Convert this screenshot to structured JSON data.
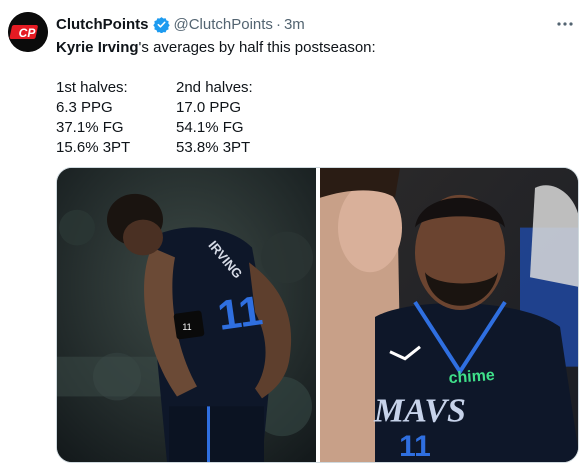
{
  "author": {
    "name": "ClutchPoints",
    "handle": "@ClutchPoints",
    "separator": "·",
    "time": "3m",
    "avatar_text": "CP",
    "verified_icon": "verified-badge-icon"
  },
  "tweet": {
    "mention": "Kyrie Irving",
    "rest": "'s averages by half this postseason:"
  },
  "stats": {
    "first": {
      "heading": "1st halves:",
      "ppg": "6.3 PPG",
      "fg": "37.1% FG",
      "three": "15.6% 3PT"
    },
    "second": {
      "heading": "2nd halves:",
      "ppg": "17.0 PPG",
      "fg": "54.1% FG",
      "three": "53.8% 3PT"
    }
  },
  "media": {
    "left_jersey_name": "IRVING",
    "left_jersey_number": "11",
    "right_sponsor": "chime",
    "right_team": "MAVS",
    "right_number": "11",
    "wristband": "11"
  },
  "colors": {
    "brand_red": "#e51b23",
    "verified_blue": "#1d9bf0",
    "jersey_navy": "#0e1729",
    "jersey_accent": "#2f6fe0",
    "sponsor_green": "#3fe08a"
  }
}
